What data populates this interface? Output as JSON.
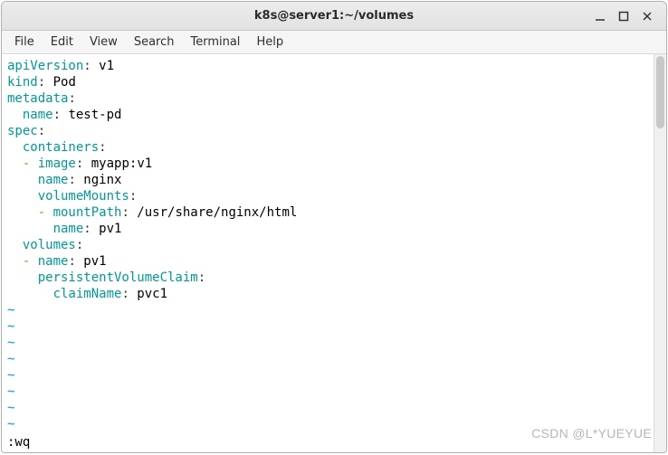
{
  "window": {
    "title": "k8s@server1:~/volumes"
  },
  "menubar": {
    "items": [
      {
        "label": "File"
      },
      {
        "label": "Edit"
      },
      {
        "label": "View"
      },
      {
        "label": "Search"
      },
      {
        "label": "Terminal"
      },
      {
        "label": "Help"
      }
    ]
  },
  "editor": {
    "lines": [
      [
        {
          "t": "apiVersion",
          "c": "k-key"
        },
        {
          "t": ":",
          "c": "k-dark"
        },
        {
          "t": " v1"
        }
      ],
      [
        {
          "t": "kind",
          "c": "k-key"
        },
        {
          "t": ":",
          "c": "k-dark"
        },
        {
          "t": " Pod"
        }
      ],
      [
        {
          "t": "metadata",
          "c": "k-key"
        },
        {
          "t": ":",
          "c": "k-dark"
        }
      ],
      [
        {
          "t": "  "
        },
        {
          "t": "name",
          "c": "k-key"
        },
        {
          "t": ":",
          "c": "k-dark"
        },
        {
          "t": " test-pd"
        }
      ],
      [
        {
          "t": "spec",
          "c": "k-key"
        },
        {
          "t": ":",
          "c": "k-dark"
        }
      ],
      [
        {
          "t": "  "
        },
        {
          "t": "containers",
          "c": "k-key"
        },
        {
          "t": ":",
          "c": "k-dark"
        }
      ],
      [
        {
          "t": "  "
        },
        {
          "t": "- ",
          "c": "k-dash"
        },
        {
          "t": "image",
          "c": "k-key"
        },
        {
          "t": ":",
          "c": "k-dark"
        },
        {
          "t": " myapp:v1"
        }
      ],
      [
        {
          "t": "    "
        },
        {
          "t": "name",
          "c": "k-key"
        },
        {
          "t": ":",
          "c": "k-dark"
        },
        {
          "t": " nginx"
        }
      ],
      [
        {
          "t": "    "
        },
        {
          "t": "volumeMounts",
          "c": "k-key"
        },
        {
          "t": ":",
          "c": "k-dark"
        }
      ],
      [
        {
          "t": "    "
        },
        {
          "t": "- ",
          "c": "k-dash"
        },
        {
          "t": "mountPath",
          "c": "k-key"
        },
        {
          "t": ":",
          "c": "k-dark"
        },
        {
          "t": " /usr/share/nginx/html"
        }
      ],
      [
        {
          "t": "      "
        },
        {
          "t": "name",
          "c": "k-key"
        },
        {
          "t": ":",
          "c": "k-dark"
        },
        {
          "t": " pv1"
        }
      ],
      [
        {
          "t": "  "
        },
        {
          "t": "volumes",
          "c": "k-key"
        },
        {
          "t": ":",
          "c": "k-dark"
        }
      ],
      [
        {
          "t": "  "
        },
        {
          "t": "- ",
          "c": "k-dash"
        },
        {
          "t": "name",
          "c": "k-key"
        },
        {
          "t": ":",
          "c": "k-dark"
        },
        {
          "t": " pv1"
        }
      ],
      [
        {
          "t": "    "
        },
        {
          "t": "persistentVolumeClaim",
          "c": "k-key"
        },
        {
          "t": ":",
          "c": "k-dark"
        }
      ],
      [
        {
          "t": "      "
        },
        {
          "t": "claimName",
          "c": "k-key"
        },
        {
          "t": ":",
          "c": "k-dark"
        },
        {
          "t": " pvc1"
        }
      ]
    ],
    "tilde_count": 8,
    "tilde": "~",
    "status": ":wq"
  },
  "watermark": "CSDN @L*YUEYUE"
}
